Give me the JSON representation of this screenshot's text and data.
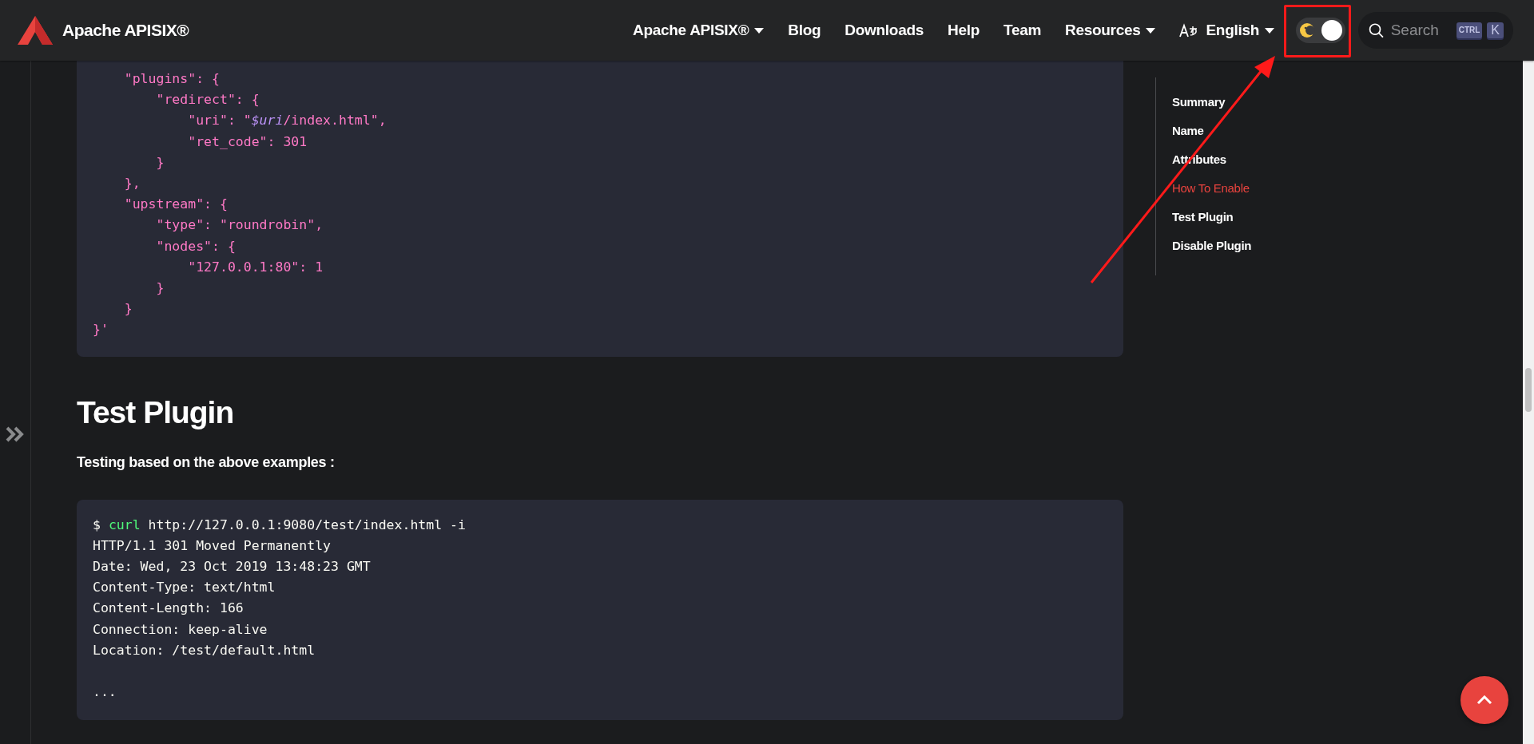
{
  "navbar": {
    "brand": "Apache APISIX®",
    "items": [
      {
        "label": "Apache APISIX®",
        "dropdown": true
      },
      {
        "label": "Blog",
        "dropdown": false
      },
      {
        "label": "Downloads",
        "dropdown": false
      },
      {
        "label": "Help",
        "dropdown": false
      },
      {
        "label": "Team",
        "dropdown": false
      },
      {
        "label": "Resources",
        "dropdown": true
      }
    ],
    "language": {
      "label": "English"
    },
    "theme_toggle": {
      "on": true
    },
    "search": {
      "placeholder": "Search",
      "keys": [
        "CTRL",
        "K"
      ]
    }
  },
  "code_block_1": [
    [
      {
        "kind": "string",
        "text": "    \"plugins\": {"
      }
    ],
    [
      {
        "kind": "string",
        "text": "        \"redirect\": {"
      }
    ],
    [
      {
        "kind": "string",
        "text": "            \"uri\": \""
      },
      {
        "kind": "variable",
        "text": "$uri"
      },
      {
        "kind": "string",
        "text": "/index.html\","
      }
    ],
    [
      {
        "kind": "string",
        "text": "            \"ret_code\": 301"
      }
    ],
    [
      {
        "kind": "string",
        "text": "        }"
      }
    ],
    [
      {
        "kind": "string",
        "text": "    },"
      }
    ],
    [
      {
        "kind": "string",
        "text": "    \"upstream\": {"
      }
    ],
    [
      {
        "kind": "string",
        "text": "        \"type\": \"roundrobin\","
      }
    ],
    [
      {
        "kind": "string",
        "text": "        \"nodes\": {"
      }
    ],
    [
      {
        "kind": "string",
        "text": "            \"127.0.0.1:80\": 1"
      }
    ],
    [
      {
        "kind": "string",
        "text": "        }"
      }
    ],
    [
      {
        "kind": "string",
        "text": "    }"
      }
    ],
    [
      {
        "kind": "string",
        "text": "}'"
      }
    ]
  ],
  "heading": "Test Plugin",
  "paragraph": "Testing based on the above examples :",
  "code_block_2": [
    [
      {
        "kind": "plain",
        "text": "$ "
      },
      {
        "kind": "command",
        "text": "curl"
      },
      {
        "kind": "plain",
        "text": " http://127.0.0.1:9080/test/index.html -i"
      }
    ],
    [
      {
        "kind": "plain",
        "text": "HTTP/1.1 301 Moved Permanently"
      }
    ],
    [
      {
        "kind": "plain",
        "text": "Date: Wed, 23 Oct 2019 13:48:23 GMT"
      }
    ],
    [
      {
        "kind": "plain",
        "text": "Content-Type: text/html"
      }
    ],
    [
      {
        "kind": "plain",
        "text": "Content-Length: 166"
      }
    ],
    [
      {
        "kind": "plain",
        "text": "Connection: keep-alive"
      }
    ],
    [
      {
        "kind": "plain",
        "text": "Location: /test/default.html"
      }
    ]
  ],
  "code_block_2_ellipsis": "...",
  "toc": [
    {
      "label": "Summary",
      "selected": false
    },
    {
      "label": "Name",
      "selected": false
    },
    {
      "label": "Attributes",
      "selected": false
    },
    {
      "label": "How To Enable",
      "selected": true
    },
    {
      "label": "Test Plugin",
      "selected": false
    },
    {
      "label": "Disable Plugin",
      "selected": false
    }
  ]
}
